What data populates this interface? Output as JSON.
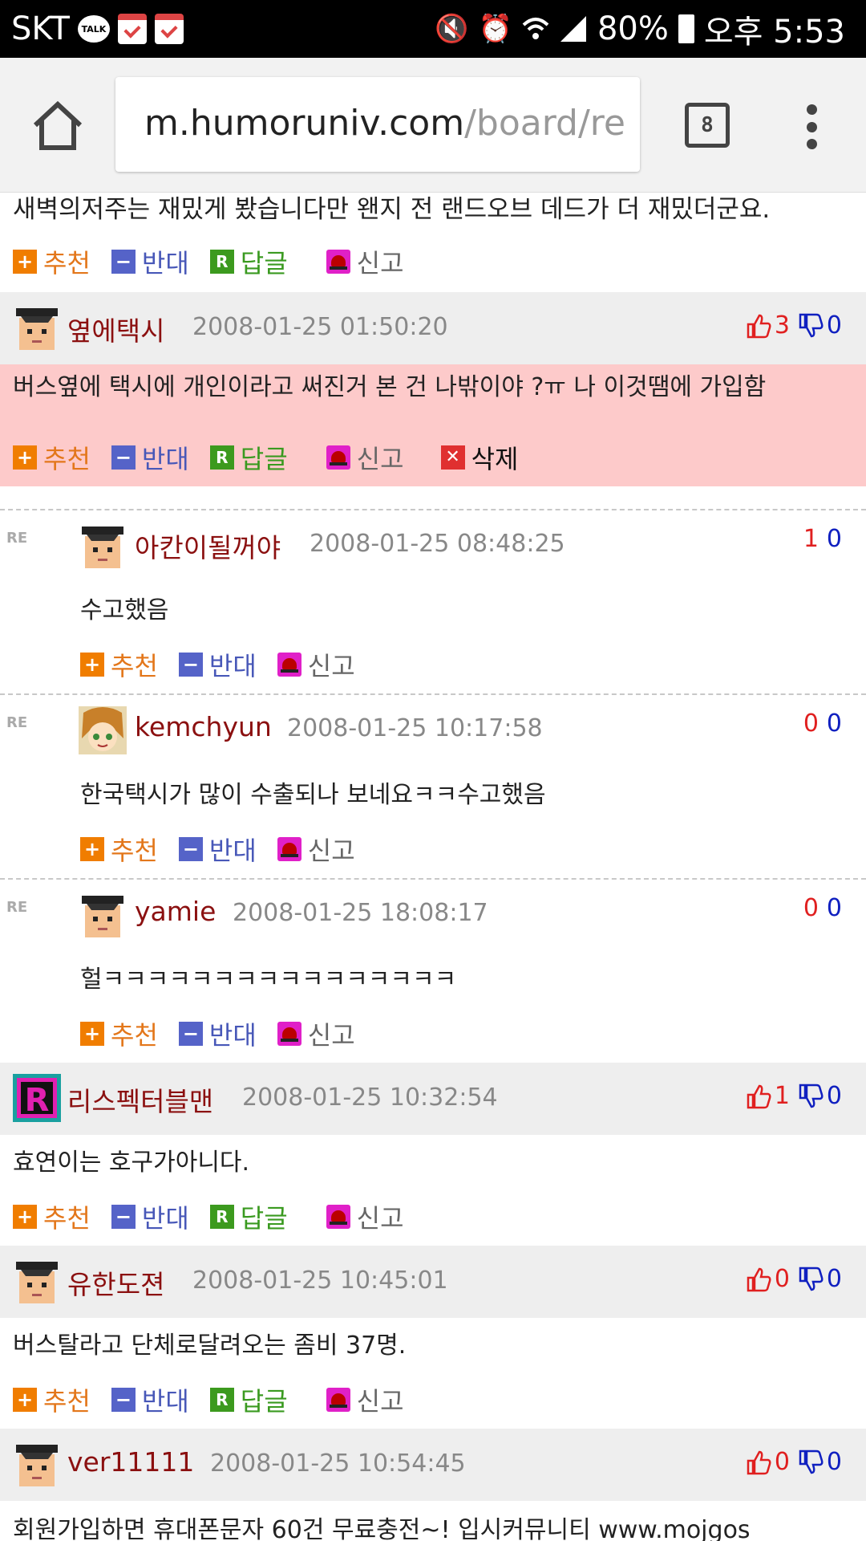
{
  "status_bar": {
    "carrier": "SKT",
    "talk_badge": "TALK",
    "battery": "80%",
    "time": "오후 5:53",
    "icons": [
      "kakaotalk-icon",
      "calendar-check-icon",
      "calendar-check-icon",
      "mute-icon",
      "alarm-icon",
      "wifi-icon",
      "signal-icon",
      "battery-icon"
    ]
  },
  "browser": {
    "url_host": "m.humoruniv.com",
    "url_path": "/board/re",
    "tab_count": "8"
  },
  "actions": {
    "recommend": "추천",
    "oppose": "반대",
    "reply": "답글",
    "report": "신고",
    "delete": "삭제",
    "re": "RE"
  },
  "comments": [
    {
      "text": "새벽의저주는 재밌게 봤습니다만 왠지 전 랜드오브 데드가 더 재밌더군요."
    },
    {
      "nick": "옆에택시",
      "date": "2008-01-25 01:50:20",
      "up": "3",
      "down": "0",
      "text": "버스옆에 택시에 개인이라고 써진거 본 건 나밖이야 ?ㅠ 나 이것땜에 가입함",
      "replies": [
        {
          "nick": "아칸이될꺼야",
          "date": "2008-01-25 08:48:25",
          "up": "1",
          "down": "0",
          "text": "수고했음"
        },
        {
          "nick": "kemchyun",
          "date": "2008-01-25 10:17:58",
          "up": "0",
          "down": "0",
          "text": "한국택시가 많이 수출되나 보네요ㅋㅋ수고했음"
        },
        {
          "nick": "yamie",
          "date": "2008-01-25 18:08:17",
          "up": "0",
          "down": "0",
          "text": "헐ㅋㅋㅋㅋㅋㅋㅋㅋㅋㅋㅋㅋㅋㅋㅋㅋ"
        }
      ]
    },
    {
      "nick": "리스펙터블맨",
      "date": "2008-01-25 10:32:54",
      "up": "1",
      "down": "0",
      "text": "효연이는 호구가아니다."
    },
    {
      "nick": "유한도젼",
      "date": "2008-01-25 10:45:01",
      "up": "0",
      "down": "0",
      "text": "버스탈라고 단체로달려오는 좀비 37명."
    },
    {
      "nick": "ver11111",
      "date": "2008-01-25 10:54:45",
      "up": "0",
      "down": "0",
      "text": "회원가입하면 휴대폰문자 60건 무료충전~! 입시커뮤니티 www.mojgos"
    }
  ]
}
